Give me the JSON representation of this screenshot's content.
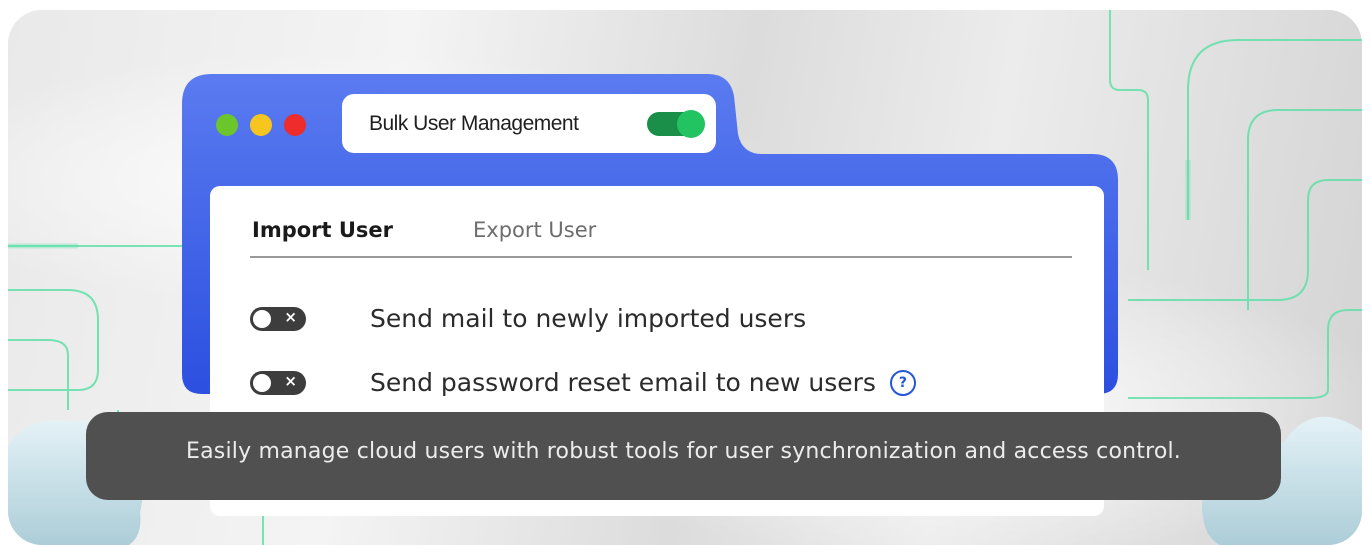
{
  "window": {
    "title": "Bulk User Management",
    "title_toggle_on": true
  },
  "tabs": [
    {
      "label": "Import User",
      "active": true
    },
    {
      "label": "Export User",
      "active": false
    }
  ],
  "options": [
    {
      "label": "Send mail to newly  imported users",
      "enabled": false,
      "icon": "toggle-off-icon"
    },
    {
      "label": "Send password reset email to new users",
      "enabled": false,
      "icon": "toggle-off-icon",
      "help_icon": "help-circle-icon"
    }
  ],
  "help_glyph": "?",
  "switch_glyph": "×",
  "caption": "Easily manage cloud users with robust tools for user synchronization and access control.",
  "colors": {
    "frame": "#3f63e6",
    "toggle_on": "#22c461",
    "help_icon": "#2457d8",
    "caption_bg": "#505050",
    "circuit": "#5fe0a9"
  }
}
